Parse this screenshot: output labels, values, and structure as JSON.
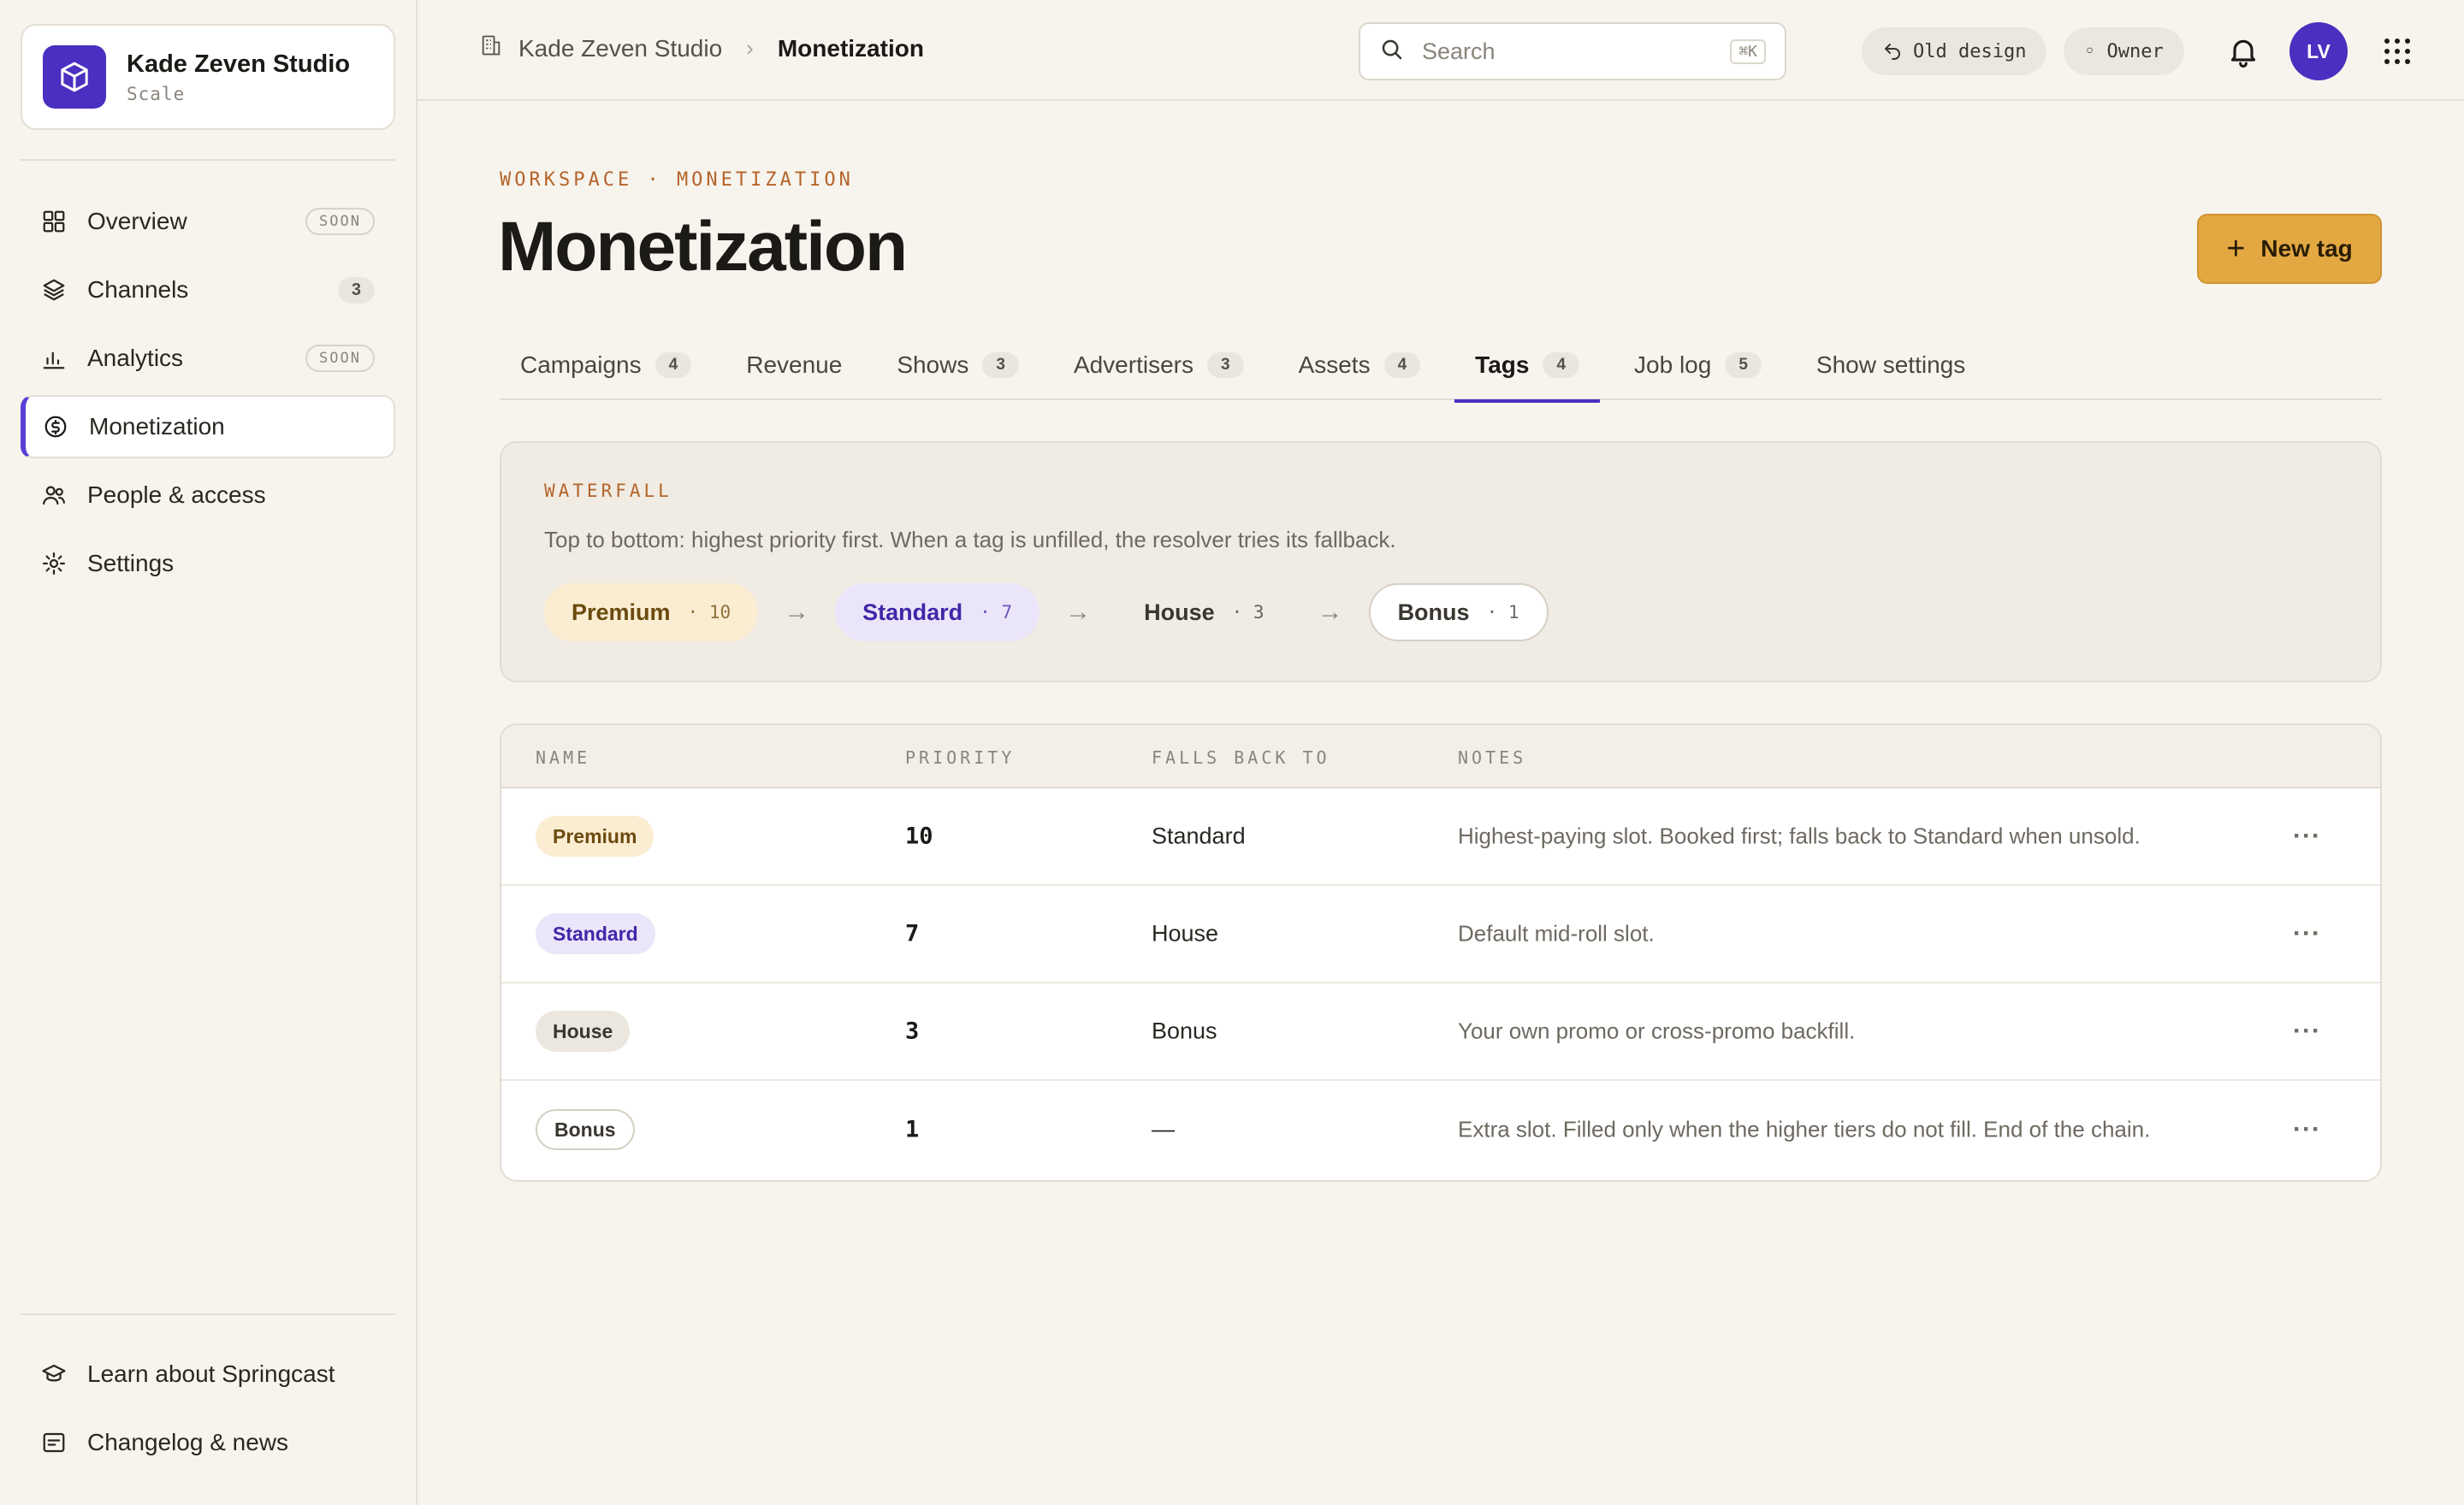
{
  "workspace": {
    "name": "Kade Zeven Studio",
    "plan": "Scale"
  },
  "sidebar": {
    "items": [
      {
        "label": "Overview",
        "badge": "SOON",
        "badge_type": "soon",
        "icon": "grid-icon"
      },
      {
        "label": "Channels",
        "badge": "3",
        "badge_type": "count",
        "icon": "layers-icon"
      },
      {
        "label": "Analytics",
        "badge": "SOON",
        "badge_type": "soon",
        "icon": "bar-chart-icon"
      },
      {
        "label": "Monetization",
        "badge": "",
        "badge_type": "",
        "icon": "dollar-circle-icon",
        "active": true
      },
      {
        "label": "People & access",
        "badge": "",
        "badge_type": "",
        "icon": "users-icon"
      },
      {
        "label": "Settings",
        "badge": "",
        "badge_type": "",
        "icon": "gear-icon"
      }
    ],
    "footer": [
      {
        "label": "Learn about Springcast",
        "icon": "graduation-cap-icon"
      },
      {
        "label": "Changelog & news",
        "icon": "news-icon"
      }
    ]
  },
  "topbar": {
    "breadcrumb": {
      "root": "Kade Zeven Studio",
      "current": "Monetization"
    },
    "search": {
      "placeholder": "Search",
      "shortcut": "⌘K"
    },
    "old_design": "Old design",
    "role": "◦ Owner",
    "avatar_initials": "LV"
  },
  "page": {
    "eyebrow": "WORKSPACE · MONETIZATION",
    "title": "Monetization",
    "new_button": "New tag"
  },
  "tabs": [
    {
      "label": "Campaigns",
      "count": "4"
    },
    {
      "label": "Revenue",
      "count": ""
    },
    {
      "label": "Shows",
      "count": "3"
    },
    {
      "label": "Advertisers",
      "count": "3"
    },
    {
      "label": "Assets",
      "count": "4"
    },
    {
      "label": "Tags",
      "count": "4",
      "active": true
    },
    {
      "label": "Job log",
      "count": "5"
    },
    {
      "label": "Show settings",
      "count": ""
    }
  ],
  "waterfall": {
    "label": "WATERFALL",
    "description": "Top to bottom: highest priority first. When a tag is unfilled, the resolver tries its fallback.",
    "steps": [
      {
        "name": "Premium",
        "priority": "· 10",
        "style": "premium"
      },
      {
        "name": "Standard",
        "priority": "· 7",
        "style": "standard"
      },
      {
        "name": "House",
        "priority": "· 3",
        "style": "house"
      },
      {
        "name": "Bonus",
        "priority": "· 1",
        "style": "bonus"
      }
    ],
    "arrow": "→"
  },
  "table": {
    "headers": {
      "name": "NAME",
      "priority": "PRIORITY",
      "fallback": "FALLS BACK TO",
      "notes": "NOTES"
    },
    "rows": [
      {
        "name": "Premium",
        "style": "premium",
        "priority": "10",
        "fallback": "Standard",
        "notes": "Highest-paying slot. Booked first; falls back to Standard when unsold."
      },
      {
        "name": "Standard",
        "style": "standard",
        "priority": "7",
        "fallback": "House",
        "notes": "Default mid-roll slot."
      },
      {
        "name": "House",
        "style": "house",
        "priority": "3",
        "fallback": "Bonus",
        "notes": "Your own promo or cross-promo backfill."
      },
      {
        "name": "Bonus",
        "style": "bonus",
        "priority": "1",
        "fallback": "—",
        "notes": "Extra slot. Filled only when the higher tiers do not fill. End of the chain."
      }
    ],
    "more_label": "···"
  },
  "colors": {
    "accent": "#4a2fc0",
    "primary_button": "#e4a843",
    "eyebrow": "#b5642a"
  }
}
